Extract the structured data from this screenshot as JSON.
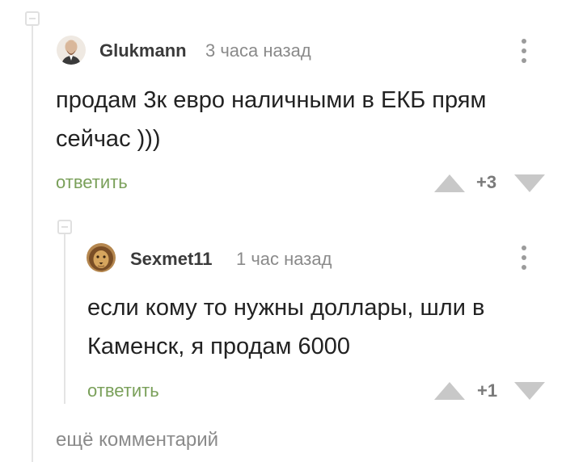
{
  "comments": [
    {
      "username": "Glukmann",
      "time": "3 часа назад",
      "text_line1": "продам 3к евро наличными в ЕКБ прям",
      "text_line2": "сейчас )))",
      "reply_label": "ответить",
      "rating": "+3"
    },
    {
      "username": "Sexmet11",
      "time": "1 час назад",
      "text_line1": "если кому то нужны доллары, шли в",
      "text_line2": "Каменск, я продам 6000",
      "reply_label": "ответить",
      "rating": "+1"
    }
  ],
  "more_comments_label": "ещё комментарий",
  "colors": {
    "accent": "#7aa05a",
    "muted": "#8a8a8a",
    "line": "#e4e4e4"
  },
  "icons": [
    "collapse-icon",
    "more-options-icon",
    "upvote-icon",
    "downvote-icon"
  ]
}
